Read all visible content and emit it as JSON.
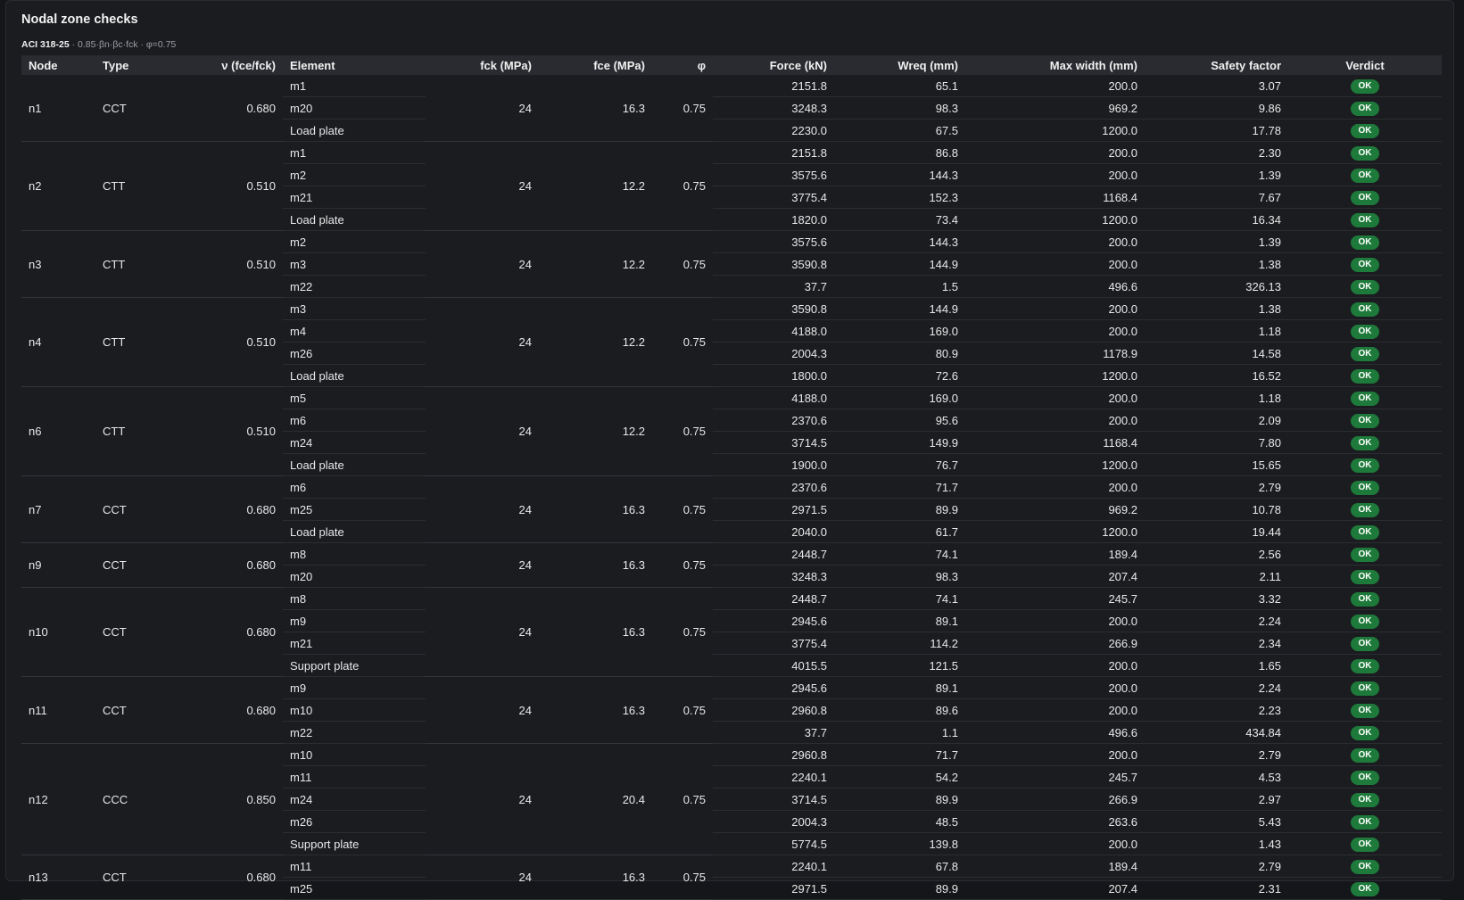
{
  "panel": {
    "title": "Nodal zone checks",
    "subtitle_code": "ACI 318-25",
    "subtitle_formula": " · 0.85·βn·βc·fck · φ=0.75"
  },
  "columns": {
    "node": "Node",
    "type": "Type",
    "nu": "ν (fce/fck)",
    "element": "Element",
    "fck": "fck (MPa)",
    "fce": "fce (MPa)",
    "phi": "φ",
    "force": "Force (kN)",
    "wreq": "Wreq (mm)",
    "maxw": "Max width (mm)",
    "sf": "Safety factor",
    "verdict": "Verdict"
  },
  "colors": {
    "ok_badge": "#1e7a3a",
    "header_bg": "#292b31",
    "panel_bg": "#1b1c20"
  },
  "nodes": [
    {
      "node": "n1",
      "type": "CCT",
      "nu": "0.680",
      "fck": "24",
      "fce": "16.3",
      "phi": "0.75",
      "rows": [
        {
          "element": "m1",
          "force": "2151.8",
          "wreq": "65.1",
          "maxw": "200.0",
          "sf": "3.07",
          "verdict": "OK"
        },
        {
          "element": "m20",
          "force": "3248.3",
          "wreq": "98.3",
          "maxw": "969.2",
          "sf": "9.86",
          "verdict": "OK"
        },
        {
          "element": "Load plate",
          "force": "2230.0",
          "wreq": "67.5",
          "maxw": "1200.0",
          "sf": "17.78",
          "verdict": "OK"
        }
      ]
    },
    {
      "node": "n2",
      "type": "CTT",
      "nu": "0.510",
      "fck": "24",
      "fce": "12.2",
      "phi": "0.75",
      "rows": [
        {
          "element": "m1",
          "force": "2151.8",
          "wreq": "86.8",
          "maxw": "200.0",
          "sf": "2.30",
          "verdict": "OK"
        },
        {
          "element": "m2",
          "force": "3575.6",
          "wreq": "144.3",
          "maxw": "200.0",
          "sf": "1.39",
          "verdict": "OK"
        },
        {
          "element": "m21",
          "force": "3775.4",
          "wreq": "152.3",
          "maxw": "1168.4",
          "sf": "7.67",
          "verdict": "OK"
        },
        {
          "element": "Load plate",
          "force": "1820.0",
          "wreq": "73.4",
          "maxw": "1200.0",
          "sf": "16.34",
          "verdict": "OK"
        }
      ]
    },
    {
      "node": "n3",
      "type": "CTT",
      "nu": "0.510",
      "fck": "24",
      "fce": "12.2",
      "phi": "0.75",
      "rows": [
        {
          "element": "m2",
          "force": "3575.6",
          "wreq": "144.3",
          "maxw": "200.0",
          "sf": "1.39",
          "verdict": "OK"
        },
        {
          "element": "m3",
          "force": "3590.8",
          "wreq": "144.9",
          "maxw": "200.0",
          "sf": "1.38",
          "verdict": "OK"
        },
        {
          "element": "m22",
          "force": "37.7",
          "wreq": "1.5",
          "maxw": "496.6",
          "sf": "326.13",
          "verdict": "OK"
        }
      ]
    },
    {
      "node": "n4",
      "type": "CTT",
      "nu": "0.510",
      "fck": "24",
      "fce": "12.2",
      "phi": "0.75",
      "rows": [
        {
          "element": "m3",
          "force": "3590.8",
          "wreq": "144.9",
          "maxw": "200.0",
          "sf": "1.38",
          "verdict": "OK"
        },
        {
          "element": "m4",
          "force": "4188.0",
          "wreq": "169.0",
          "maxw": "200.0",
          "sf": "1.18",
          "verdict": "OK"
        },
        {
          "element": "m26",
          "force": "2004.3",
          "wreq": "80.9",
          "maxw": "1178.9",
          "sf": "14.58",
          "verdict": "OK"
        },
        {
          "element": "Load plate",
          "force": "1800.0",
          "wreq": "72.6",
          "maxw": "1200.0",
          "sf": "16.52",
          "verdict": "OK"
        }
      ]
    },
    {
      "node": "n6",
      "type": "CTT",
      "nu": "0.510",
      "fck": "24",
      "fce": "12.2",
      "phi": "0.75",
      "rows": [
        {
          "element": "m5",
          "force": "4188.0",
          "wreq": "169.0",
          "maxw": "200.0",
          "sf": "1.18",
          "verdict": "OK"
        },
        {
          "element": "m6",
          "force": "2370.6",
          "wreq": "95.6",
          "maxw": "200.0",
          "sf": "2.09",
          "verdict": "OK"
        },
        {
          "element": "m24",
          "force": "3714.5",
          "wreq": "149.9",
          "maxw": "1168.4",
          "sf": "7.80",
          "verdict": "OK"
        },
        {
          "element": "Load plate",
          "force": "1900.0",
          "wreq": "76.7",
          "maxw": "1200.0",
          "sf": "15.65",
          "verdict": "OK"
        }
      ]
    },
    {
      "node": "n7",
      "type": "CCT",
      "nu": "0.680",
      "fck": "24",
      "fce": "16.3",
      "phi": "0.75",
      "rows": [
        {
          "element": "m6",
          "force": "2370.6",
          "wreq": "71.7",
          "maxw": "200.0",
          "sf": "2.79",
          "verdict": "OK"
        },
        {
          "element": "m25",
          "force": "2971.5",
          "wreq": "89.9",
          "maxw": "969.2",
          "sf": "10.78",
          "verdict": "OK"
        },
        {
          "element": "Load plate",
          "force": "2040.0",
          "wreq": "61.7",
          "maxw": "1200.0",
          "sf": "19.44",
          "verdict": "OK"
        }
      ]
    },
    {
      "node": "n9",
      "type": "CCT",
      "nu": "0.680",
      "fck": "24",
      "fce": "16.3",
      "phi": "0.75",
      "rows": [
        {
          "element": "m8",
          "force": "2448.7",
          "wreq": "74.1",
          "maxw": "189.4",
          "sf": "2.56",
          "verdict": "OK"
        },
        {
          "element": "m20",
          "force": "3248.3",
          "wreq": "98.3",
          "maxw": "207.4",
          "sf": "2.11",
          "verdict": "OK"
        }
      ]
    },
    {
      "node": "n10",
      "type": "CCT",
      "nu": "0.680",
      "fck": "24",
      "fce": "16.3",
      "phi": "0.75",
      "rows": [
        {
          "element": "m8",
          "force": "2448.7",
          "wreq": "74.1",
          "maxw": "245.7",
          "sf": "3.32",
          "verdict": "OK"
        },
        {
          "element": "m9",
          "force": "2945.6",
          "wreq": "89.1",
          "maxw": "200.0",
          "sf": "2.24",
          "verdict": "OK"
        },
        {
          "element": "m21",
          "force": "3775.4",
          "wreq": "114.2",
          "maxw": "266.9",
          "sf": "2.34",
          "verdict": "OK"
        },
        {
          "element": "Support plate",
          "force": "4015.5",
          "wreq": "121.5",
          "maxw": "200.0",
          "sf": "1.65",
          "verdict": "OK"
        }
      ]
    },
    {
      "node": "n11",
      "type": "CCT",
      "nu": "0.680",
      "fck": "24",
      "fce": "16.3",
      "phi": "0.75",
      "rows": [
        {
          "element": "m9",
          "force": "2945.6",
          "wreq": "89.1",
          "maxw": "200.0",
          "sf": "2.24",
          "verdict": "OK"
        },
        {
          "element": "m10",
          "force": "2960.8",
          "wreq": "89.6",
          "maxw": "200.0",
          "sf": "2.23",
          "verdict": "OK"
        },
        {
          "element": "m22",
          "force": "37.7",
          "wreq": "1.1",
          "maxw": "496.6",
          "sf": "434.84",
          "verdict": "OK"
        }
      ]
    },
    {
      "node": "n12",
      "type": "CCC",
      "nu": "0.850",
      "fck": "24",
      "fce": "20.4",
      "phi": "0.75",
      "rows": [
        {
          "element": "m10",
          "force": "2960.8",
          "wreq": "71.7",
          "maxw": "200.0",
          "sf": "2.79",
          "verdict": "OK"
        },
        {
          "element": "m11",
          "force": "2240.1",
          "wreq": "54.2",
          "maxw": "245.7",
          "sf": "4.53",
          "verdict": "OK"
        },
        {
          "element": "m24",
          "force": "3714.5",
          "wreq": "89.9",
          "maxw": "266.9",
          "sf": "2.97",
          "verdict": "OK"
        },
        {
          "element": "m26",
          "force": "2004.3",
          "wreq": "48.5",
          "maxw": "263.6",
          "sf": "5.43",
          "verdict": "OK"
        },
        {
          "element": "Support plate",
          "force": "5774.5",
          "wreq": "139.8",
          "maxw": "200.0",
          "sf": "1.43",
          "verdict": "OK"
        }
      ]
    },
    {
      "node": "n13",
      "type": "CCT",
      "nu": "0.680",
      "fck": "24",
      "fce": "16.3",
      "phi": "0.75",
      "rows": [
        {
          "element": "m11",
          "force": "2240.1",
          "wreq": "67.8",
          "maxw": "189.4",
          "sf": "2.79",
          "verdict": "OK"
        },
        {
          "element": "m25",
          "force": "2971.5",
          "wreq": "89.9",
          "maxw": "207.4",
          "sf": "2.31",
          "verdict": "OK"
        }
      ]
    }
  ]
}
